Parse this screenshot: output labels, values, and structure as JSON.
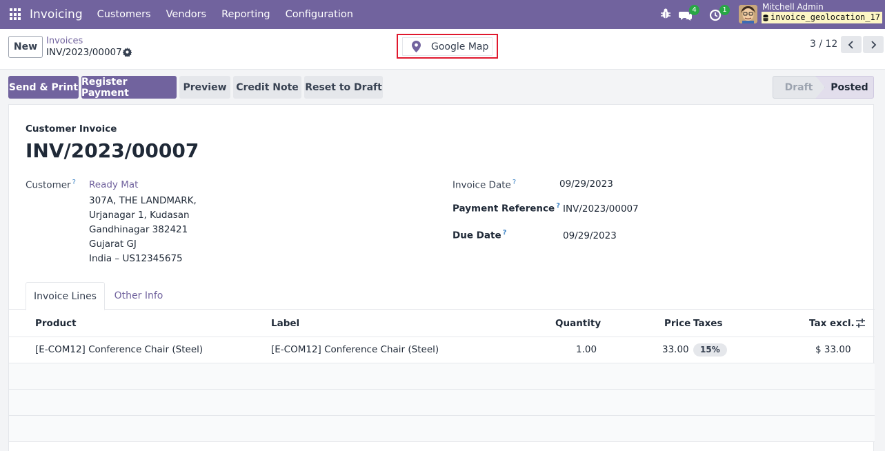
{
  "navbar": {
    "app_name": "Invoicing",
    "menu": [
      "Customers",
      "Vendors",
      "Reporting",
      "Configuration"
    ],
    "messages_badge": "4",
    "activities_badge": "1",
    "user_name": "Mitchell Admin",
    "database": "invoice_geolocation_17"
  },
  "control": {
    "new_label": "New",
    "breadcrumb_parent": "Invoices",
    "breadcrumb_current": "INV/2023/00007",
    "map_button_label": "Google Map",
    "pager": "3 / 12"
  },
  "actions": {
    "send_print": "Send & Print",
    "register_payment": "Register Payment",
    "preview": "Preview",
    "credit_note": "Credit Note",
    "reset_to_draft": "Reset to Draft"
  },
  "status": {
    "stages": [
      "Draft",
      "Posted"
    ],
    "current": "Posted"
  },
  "form": {
    "document_type": "Customer Invoice",
    "name": "INV/2023/00007",
    "customer_label": "Customer",
    "customer_name": "Ready Mat",
    "address_lines": [
      "307A, THE LANDMARK,",
      "Urjanagar 1, Kudasan",
      "Gandhinagar 382421",
      "Gujarat GJ",
      "India – US12345675"
    ],
    "invoice_date_label": "Invoice Date",
    "invoice_date": "09/29/2023",
    "payment_reference_label": "Payment Reference",
    "payment_reference": "INV/2023/00007",
    "due_date_label": "Due Date",
    "due_date": "09/29/2023",
    "help_mark": "?"
  },
  "tabs": [
    "Invoice Lines",
    "Other Info"
  ],
  "table": {
    "columns": [
      "Product",
      "Label",
      "Quantity",
      "Price",
      "Taxes",
      "Tax excl."
    ],
    "rows": [
      {
        "product": "[E-COM12] Conference Chair (Steel)",
        "label": "[E-COM12] Conference Chair (Steel)",
        "quantity": "1.00",
        "price": "33.00",
        "taxes": "15%",
        "tax_excl": "$ 33.00"
      }
    ]
  },
  "colors": {
    "brand": "#71639e",
    "highlight_frame": "#e0182d",
    "badge_green": "#28a745"
  }
}
